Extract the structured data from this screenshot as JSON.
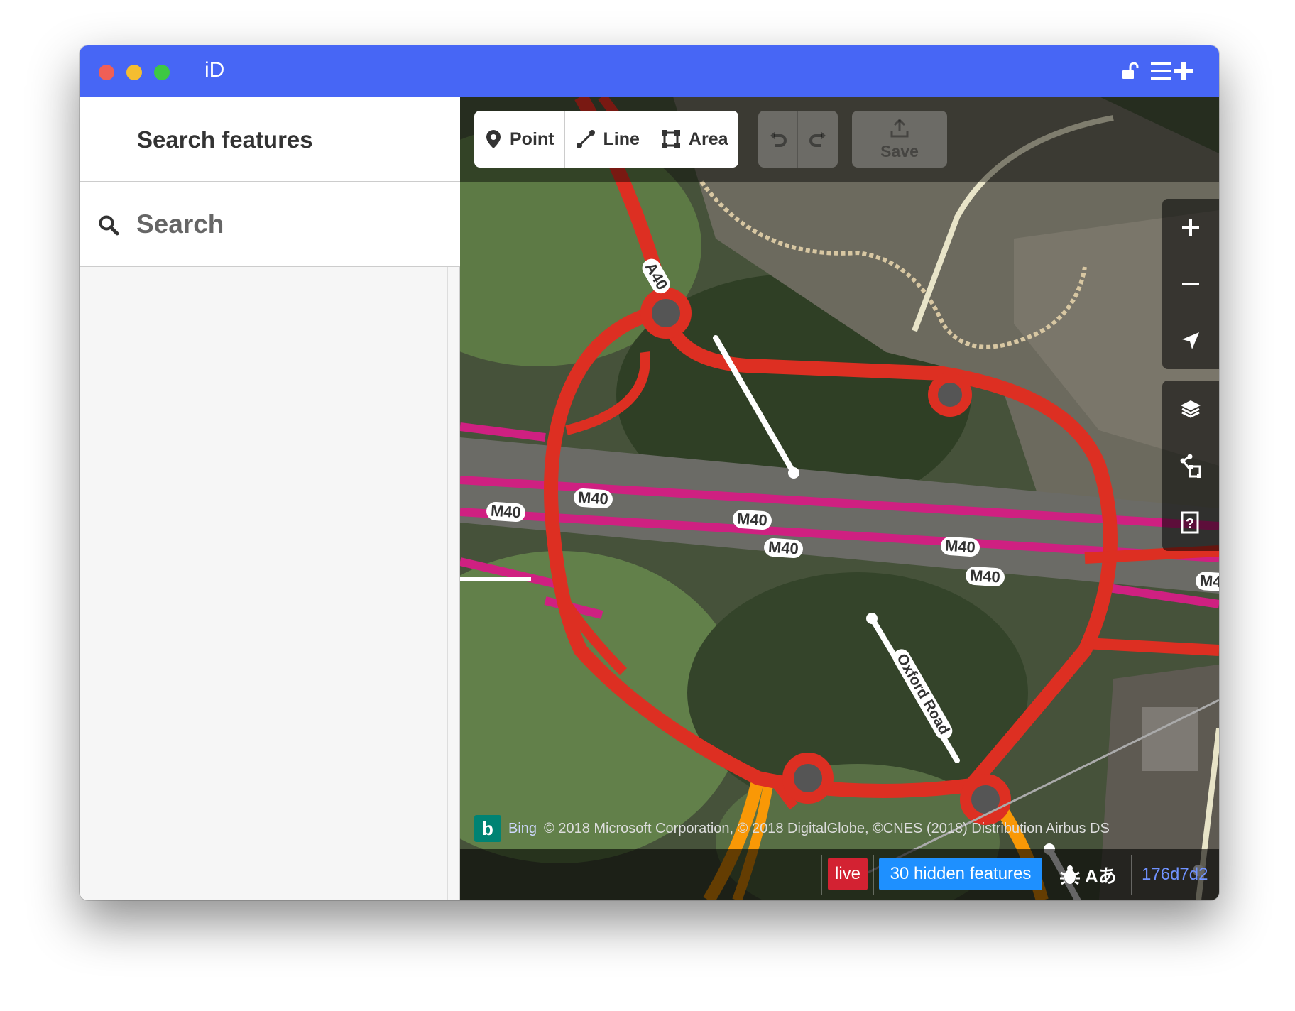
{
  "window": {
    "title": "iD"
  },
  "sidebar": {
    "title": "Search features",
    "search_placeholder": "Search"
  },
  "toolbar": {
    "modes": [
      {
        "label": "Point",
        "icon": "point-icon"
      },
      {
        "label": "Line",
        "icon": "line-icon"
      },
      {
        "label": "Area",
        "icon": "area-icon"
      }
    ],
    "save_label": "Save"
  },
  "map": {
    "road_labels": {
      "a40": "A40",
      "m40_1": "M40",
      "m40_2": "M40",
      "m40_3": "M40",
      "m40_4": "M40",
      "m40_5": "M40",
      "m40_6": "M40",
      "m40_7": "M4",
      "oxford_road": "Oxford Road"
    },
    "colors": {
      "trunk": "#dd2f22",
      "motorway": "#cf2081",
      "secondary": "#f99806",
      "titlebar": "#4766f5"
    }
  },
  "attribution": {
    "provider": "Bing",
    "text": "© 2018 Microsoft Corporation, © 2018 DigitalGlobe, ©CNES (2018) Distribution Airbus DS"
  },
  "footer": {
    "live_label": "live",
    "hidden_features": "30 hidden features",
    "language_glyph": "Aあ",
    "version": "176d7d2"
  }
}
